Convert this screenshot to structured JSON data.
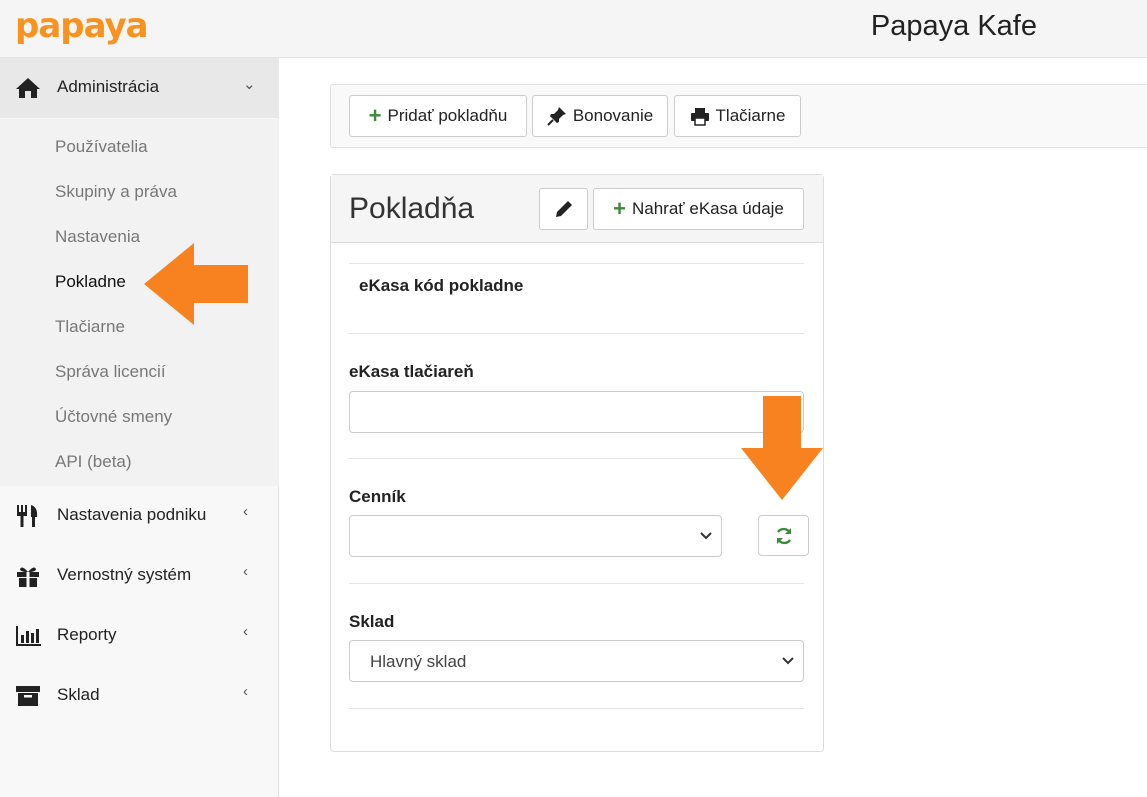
{
  "header": {
    "logo_text": "papaya",
    "brand_name": "Papaya Kafe"
  },
  "sidebar": {
    "sections": [
      {
        "label": "Administrácia",
        "icon": "home-icon",
        "expanded": true
      },
      {
        "label": "Nastavenia podniku",
        "icon": "utensils-icon",
        "expanded": false
      },
      {
        "label": "Vernostný systém",
        "icon": "gift-icon",
        "expanded": false
      },
      {
        "label": "Reporty",
        "icon": "bar-chart-icon",
        "expanded": false
      },
      {
        "label": "Sklad",
        "icon": "archive-box-icon",
        "expanded": false
      }
    ],
    "admin_items": [
      "Používatelia",
      "Skupiny a práva",
      "Nastavenia",
      "Pokladne",
      "Tlačiarne",
      "Správa licencií",
      "Účtovné smeny",
      "API (beta)"
    ],
    "current_item": "Pokladne"
  },
  "toolbar": {
    "add_register_label": "Pridať pokladňu",
    "tagging_label": "Bonovanie",
    "printers_label": "Tlačiarne"
  },
  "panel": {
    "title": "Pokladňa",
    "upload_ekasa_label": "Nahrať eKasa údaje",
    "ekasa_code_label": "eKasa kód pokladne",
    "ekasa_printer_label": "eKasa tlačiareň",
    "ekasa_printer_value": "",
    "price_list_label": "Cenník",
    "price_list_value": "",
    "warehouse_label": "Sklad",
    "warehouse_value": "Hlavný sklad"
  },
  "colors": {
    "accent_orange": "#f7821f",
    "plus_green": "#3c8a3c",
    "refresh_green": "#3c8a3c"
  }
}
